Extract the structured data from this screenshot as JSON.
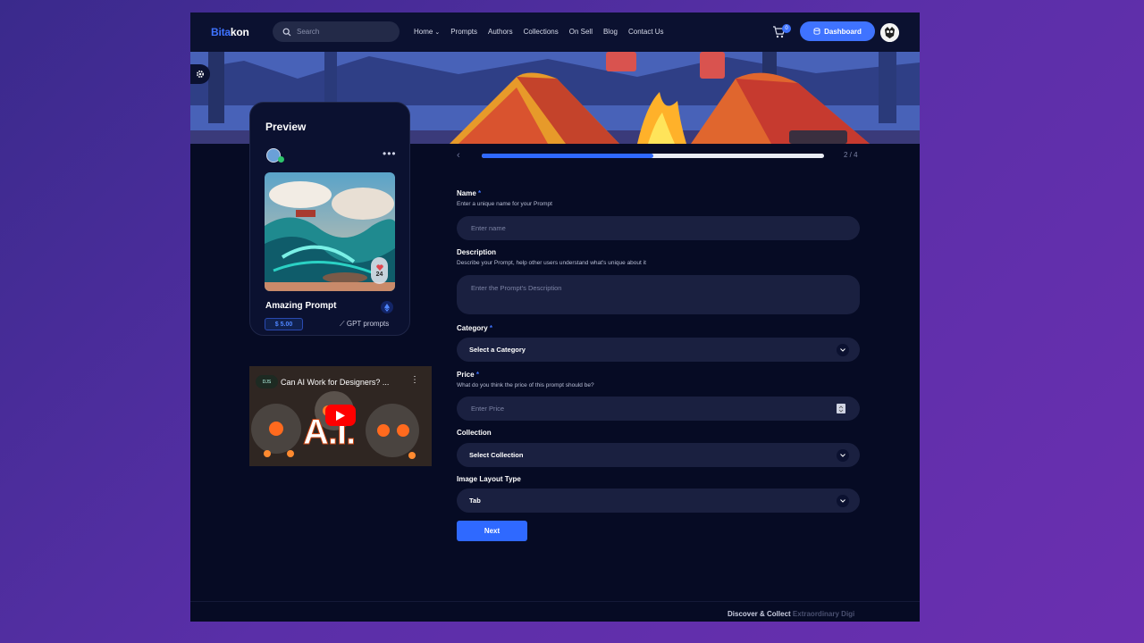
{
  "header": {
    "logo_part1": "Bita",
    "logo_part2": "kon",
    "search_placeholder": "Search",
    "nav": [
      "Home",
      "Prompts",
      "Authors",
      "Collections",
      "On Sell",
      "Blog",
      "Contact Us"
    ],
    "cart_count": "0",
    "dashboard_label": "Dashboard"
  },
  "preview": {
    "title": "Preview",
    "card_name": "Amazing Prompt",
    "price": "$ 5.00",
    "type": "GPT prompts",
    "likes": "24"
  },
  "video": {
    "title": "Can AI Work for Designers? ...",
    "channel": "DJS",
    "overlay_text": "A.I."
  },
  "progress": {
    "step_text": "2 / 4",
    "fraction": 0.5
  },
  "form": {
    "name_label": "Name",
    "name_hint": "Enter a unique name for your Prompt",
    "name_placeholder": "Enter name",
    "description_label": "Description",
    "description_hint": "Describe your Prompt, help other users understand what's unique about it",
    "description_placeholder": "Enter the Prompt's Description",
    "category_label": "Category",
    "category_value": "Select a Category",
    "price_label": "Price",
    "price_hint": "What do you think the price of this prompt should be?",
    "price_placeholder": "Enter Price",
    "collection_label": "Collection",
    "collection_value": "Select Collection",
    "layout_label": "Image Layout Type",
    "layout_value": "Tab",
    "required_mark": "*",
    "next_label": "Next"
  },
  "footer": {
    "text_main": "Discover & Collect ",
    "text_fade": "Extraordinary Digi"
  },
  "colors": {
    "accent": "#3f73ff",
    "background": "#060b24",
    "header": "#0b1130",
    "field": "#1a2040"
  }
}
